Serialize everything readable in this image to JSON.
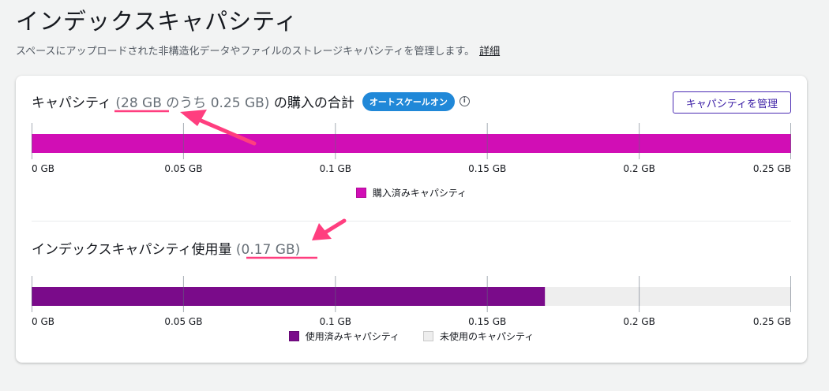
{
  "page": {
    "title": "インデックスキャパシティ",
    "subtitle": "スペースにアップロードされた非構造化データやファイルのストレージキャパシティを管理します。",
    "details_link": "詳細"
  },
  "purchased": {
    "title_main": "キャパシティ",
    "title_detail": "(28 GB のうち 0.25 GB)",
    "title_suffix": "の購入の合計",
    "badge": "オートスケールオン",
    "manage_button": "キャパシティを管理",
    "legend": [
      "購入済みキャパシティ"
    ]
  },
  "usage": {
    "title_main": "インデックスキャパシティ使用量",
    "title_detail": "(0.17 GB)",
    "legend": [
      "使用済みキャパシティ",
      "未使用のキャパシティ"
    ]
  },
  "colors": {
    "purchased": "#d10eb5",
    "used": "#7a0b8a",
    "unused": "#eeeeee",
    "accent": "#ff3e7f"
  },
  "chart_data": [
    {
      "type": "bar",
      "orientation": "horizontal-stacked",
      "xlim": [
        0,
        0.25
      ],
      "ticks": [
        "0 GB",
        "0.05 GB",
        "0.1 GB",
        "0.15 GB",
        "0.2 GB",
        "0.25 GB"
      ],
      "series": [
        {
          "name": "購入済みキャパシティ",
          "values": [
            0.25
          ]
        }
      ]
    },
    {
      "type": "bar",
      "orientation": "horizontal-stacked",
      "xlim": [
        0,
        0.25
      ],
      "ticks": [
        "0 GB",
        "0.05 GB",
        "0.1 GB",
        "0.15 GB",
        "0.2 GB",
        "0.25 GB"
      ],
      "series": [
        {
          "name": "使用済みキャパシティ",
          "values": [
            0.169
          ]
        },
        {
          "name": "未使用のキャパシティ",
          "values": [
            0.081
          ]
        }
      ]
    }
  ]
}
